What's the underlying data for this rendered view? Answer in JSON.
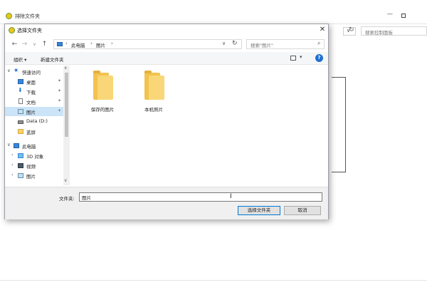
{
  "background_window": {
    "title": "排除文件夹",
    "search_placeholder": "搜索控制面板",
    "dropdown": "∨",
    "refresh": "↻",
    "minimize": "—"
  },
  "dialog": {
    "title": "选择文件夹",
    "close": "✕",
    "nav": {
      "back": "←",
      "forward": "→",
      "history": "∨",
      "up": "↑"
    },
    "address": {
      "crumbs": [
        "此电脑",
        "图片"
      ],
      "sep": "›",
      "dropdown": "∨",
      "refresh": "↻"
    },
    "search": {
      "placeholder": "搜索\"图片\"",
      "icon": "⌕"
    },
    "toolbar": {
      "organize": "组织 ▾",
      "new_folder": "新建文件夹",
      "view_dropdown": "▾",
      "help": "?"
    },
    "tree": {
      "items": [
        {
          "label": "快速访问",
          "expander": "∨",
          "icon": "star-icon"
        },
        {
          "label": "桌面",
          "pin": "✦",
          "icon": "desktop-icon"
        },
        {
          "label": "下载",
          "pin": "✦",
          "icon": "download-icon"
        },
        {
          "label": "文档",
          "pin": "✦",
          "icon": "document-icon"
        },
        {
          "label": "图片",
          "pin": "✦",
          "icon": "pictures-icon"
        },
        {
          "label": "Data (D:)",
          "icon": "drive-icon"
        },
        {
          "label": "蓝屏",
          "icon": "folder-icon"
        },
        {
          "label": "此电脑",
          "expander": "∨",
          "icon": "pc-icon"
        },
        {
          "label": "3D 对象",
          "expander": "›",
          "icon": "3d-objects-icon"
        },
        {
          "label": "视频",
          "expander": "›",
          "icon": "video-icon"
        },
        {
          "label": "图片",
          "expander": "›",
          "icon": "pictures-icon"
        }
      ],
      "scroll_up": "∧",
      "scroll_down": "∨"
    },
    "folders": [
      {
        "label": "保存的图片"
      },
      {
        "label": "本机照片"
      }
    ],
    "footer": {
      "folder_label": "文件夹:",
      "folder_value": "图片",
      "select_button": "选择文件夹",
      "cancel_button": "取消"
    }
  }
}
